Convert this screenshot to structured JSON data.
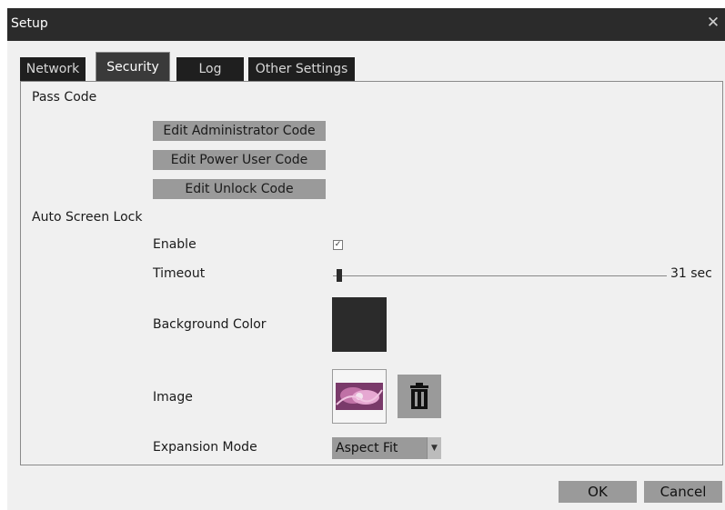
{
  "window": {
    "title": "Setup",
    "close_icon": "close-icon"
  },
  "tabs": [
    {
      "label": "Network",
      "active": false
    },
    {
      "label": "Security",
      "active": true
    },
    {
      "label": "Log",
      "active": false
    },
    {
      "label": "Other Settings",
      "active": false
    }
  ],
  "pass_code": {
    "section_label": "Pass Code",
    "edit_admin_label": "Edit Administrator Code",
    "edit_power_user_label": "Edit Power User Code",
    "edit_unlock_label": "Edit Unlock Code"
  },
  "auto_screen_lock": {
    "section_label": "Auto Screen Lock",
    "enable_label": "Enable",
    "enable_checked": true,
    "timeout_label": "Timeout",
    "timeout_value": "31 sec",
    "timeout_slider_fraction": 0.01,
    "background_color_label": "Background Color",
    "background_color": "#2b2b2b",
    "image_label": "Image",
    "trash_icon": "trash-icon",
    "expansion_mode_label": "Expansion Mode",
    "expansion_mode_value": "Aspect Fit"
  },
  "footer": {
    "ok_label": "OK",
    "cancel_label": "Cancel"
  }
}
